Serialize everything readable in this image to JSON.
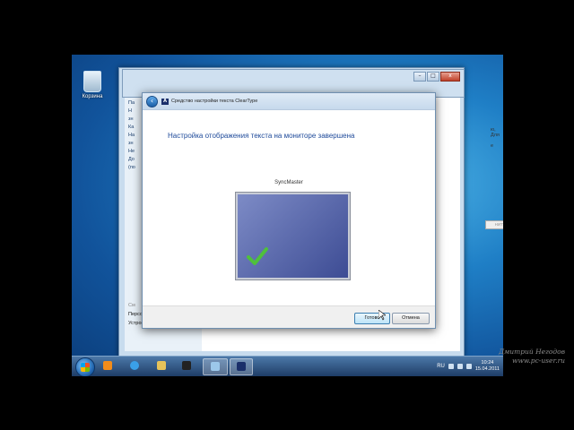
{
  "desktop": {
    "recycle_bin_label": "Корзина"
  },
  "control_panel": {
    "side_items": [
      "Па",
      "Н",
      "зн",
      "Ка",
      "На",
      "зн",
      "Не",
      "До",
      "(по"
    ],
    "side_bottom_header": "См",
    "side_bottom_items": [
      "Персонализация",
      "Устройства и принтеры"
    ],
    "right_fragments": [
      "ю, Для",
      "е",
      "нить"
    ]
  },
  "dialog": {
    "title": "Средство настройки текста ClearType",
    "heading": "Настройка отображения текста на мониторе завершена",
    "monitor_name": "SyncMaster",
    "done_label": "Готово",
    "cancel_label": "Отмена"
  },
  "taskbar": {
    "language": "RU",
    "time": "10:24",
    "date": "15.04.2011",
    "items": [
      "media-player",
      "internet-explorer",
      "explorer",
      "video",
      "control-panel",
      "cleartype"
    ]
  },
  "watermark": {
    "line1": "Дмитрий Негодов",
    "line2": "www.pc-user.ru"
  },
  "colors": {
    "accent": "#1e4a9a",
    "check": "#4fc13b"
  }
}
